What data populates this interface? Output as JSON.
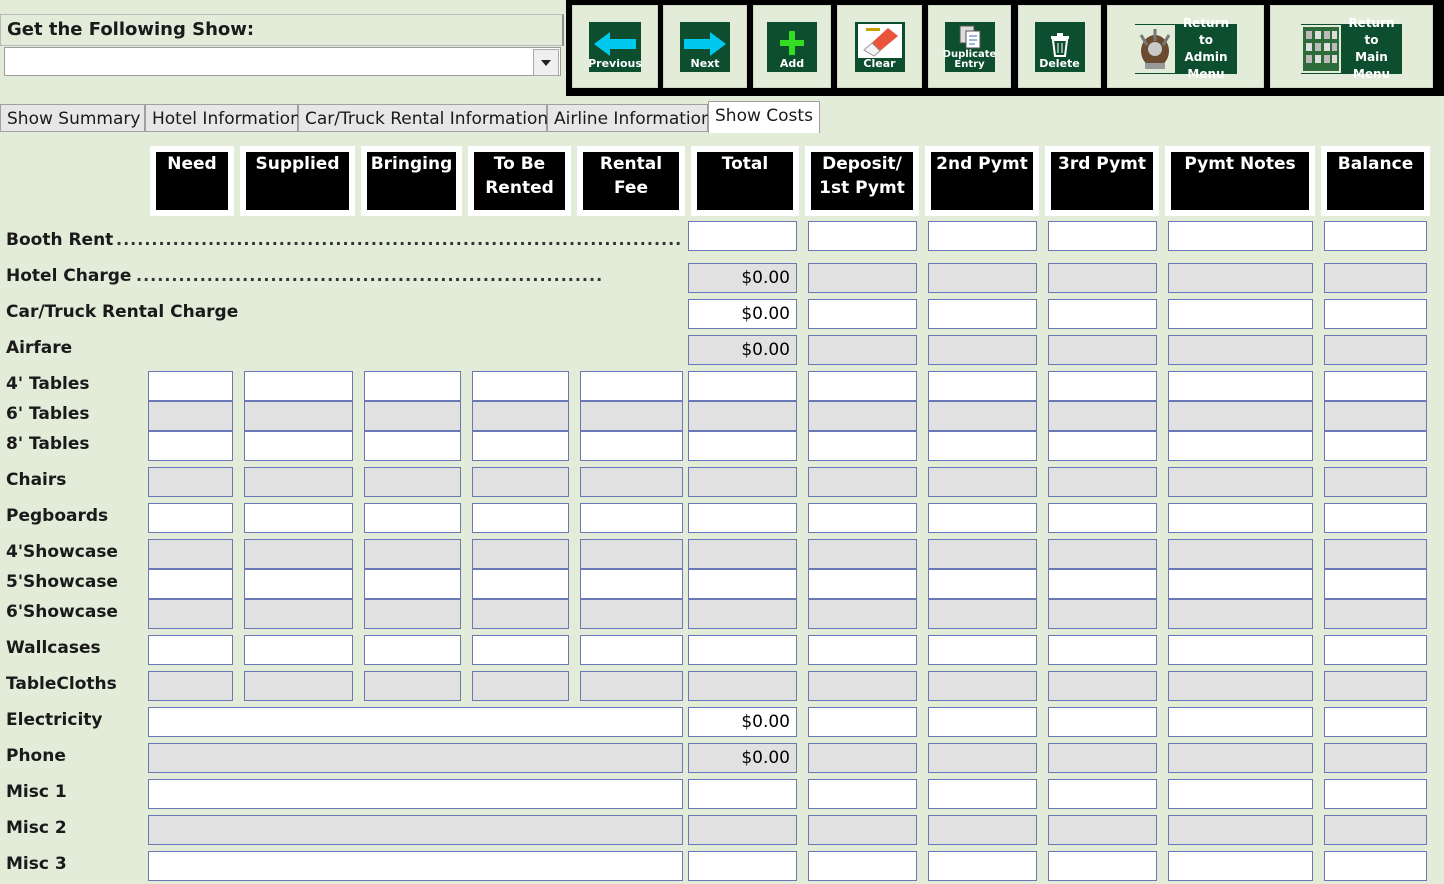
{
  "header": {
    "get_show_label": "Get the Following Show:",
    "get_show_value": ""
  },
  "toolbar": {
    "previous": "Previous",
    "next": "Next",
    "add": "Add",
    "clear": "Clear",
    "duplicate_line1": "Duplicate",
    "duplicate_line2": "Entry",
    "delete": "Delete",
    "admin_line1": "Return to",
    "admin_line2": "Admin",
    "admin_line3": "Menu",
    "main_line1": "Return to",
    "main_line2": "Main",
    "main_line3": "Menu"
  },
  "tabs": [
    "Show Summary",
    "Hotel Information",
    "Car/Truck Rental Information",
    "Airline Information",
    "Show Costs"
  ],
  "active_tab": "Show Costs",
  "columns": {
    "need": "Need",
    "supplied": "Supplied",
    "bringing": "Bringing",
    "to_be_rented_1": "To Be",
    "to_be_rented_2": "Rented",
    "rental_fee_1": "Rental",
    "rental_fee_2": "Fee",
    "total": "Total",
    "deposit_1": "Deposit/",
    "deposit_2": "1st Pymt",
    "second_pymt": "2nd Pymt",
    "third_pymt": "3rd Pymt",
    "pymt_notes": "Pymt Notes",
    "balance": "Balance"
  },
  "rows": {
    "booth_rent": {
      "label": "Booth Rent",
      "total": ""
    },
    "hotel_charge": {
      "label": "Hotel Charge",
      "total": "$0.00"
    },
    "car_truck": {
      "label": "Car/Truck Rental Charge",
      "total": "$0.00"
    },
    "airfare": {
      "label": "Airfare",
      "total": "$0.00"
    },
    "tables4": {
      "label": "4' Tables"
    },
    "tables6": {
      "label": "6' Tables"
    },
    "tables8": {
      "label": "8' Tables"
    },
    "chairs": {
      "label": "Chairs"
    },
    "pegboards": {
      "label": "Pegboards"
    },
    "showcase4": {
      "label": "4'Showcase"
    },
    "showcase5": {
      "label": "5'Showcase"
    },
    "showcase6": {
      "label": "6'Showcase"
    },
    "wallcases": {
      "label": "Wallcases"
    },
    "tablecloths": {
      "label": "TableCloths"
    },
    "electricity": {
      "label": "Electricity",
      "total": "$0.00"
    },
    "phone": {
      "label": "Phone",
      "total": "$0.00"
    },
    "misc1": {
      "label": "Misc 1"
    },
    "misc2": {
      "label": "Misc 2"
    },
    "misc3": {
      "label": "Misc 3"
    }
  },
  "colors": {
    "form_bg": "#e3ebd9",
    "button_green": "#0c4e2d",
    "arrow_cyan": "#00c8ef",
    "field_border": "#6a78b5"
  }
}
